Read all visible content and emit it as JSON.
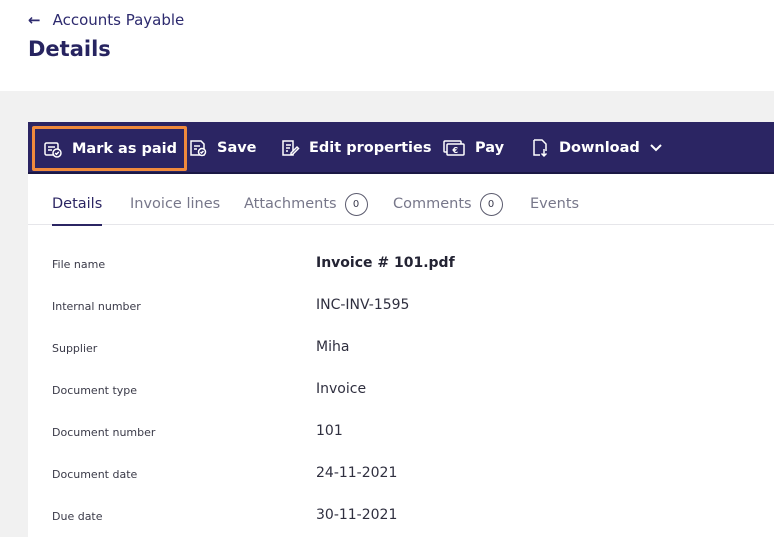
{
  "header": {
    "back_label": "Accounts Payable",
    "title": "Details"
  },
  "toolbar": {
    "buttons": [
      {
        "label": "Mark as paid",
        "icon": "mark-paid-icon"
      },
      {
        "label": "Save",
        "icon": "save-icon"
      },
      {
        "label": "Edit properties",
        "icon": "edit-properties-icon"
      },
      {
        "label": "Pay",
        "icon": "pay-icon"
      },
      {
        "label": "Download",
        "icon": "download-icon"
      }
    ],
    "highlight_color": "#f08a3c",
    "background": "#2b2563"
  },
  "tabs": [
    {
      "label": "Details",
      "active": true
    },
    {
      "label": "Invoice lines"
    },
    {
      "label": "Attachments",
      "count": "0"
    },
    {
      "label": "Comments",
      "count": "0"
    },
    {
      "label": "Events"
    }
  ],
  "fields": [
    {
      "label": "File name",
      "value": "Invoice # 101.pdf"
    },
    {
      "label": "Internal number",
      "value": "INC-INV-1595"
    },
    {
      "label": "Supplier",
      "value": "Miha"
    },
    {
      "label": "Document type",
      "value": "Invoice"
    },
    {
      "label": "Document number",
      "value": "101"
    },
    {
      "label": "Document date",
      "value": "24-11-2021"
    },
    {
      "label": "Due date",
      "value": "30-11-2021"
    }
  ]
}
